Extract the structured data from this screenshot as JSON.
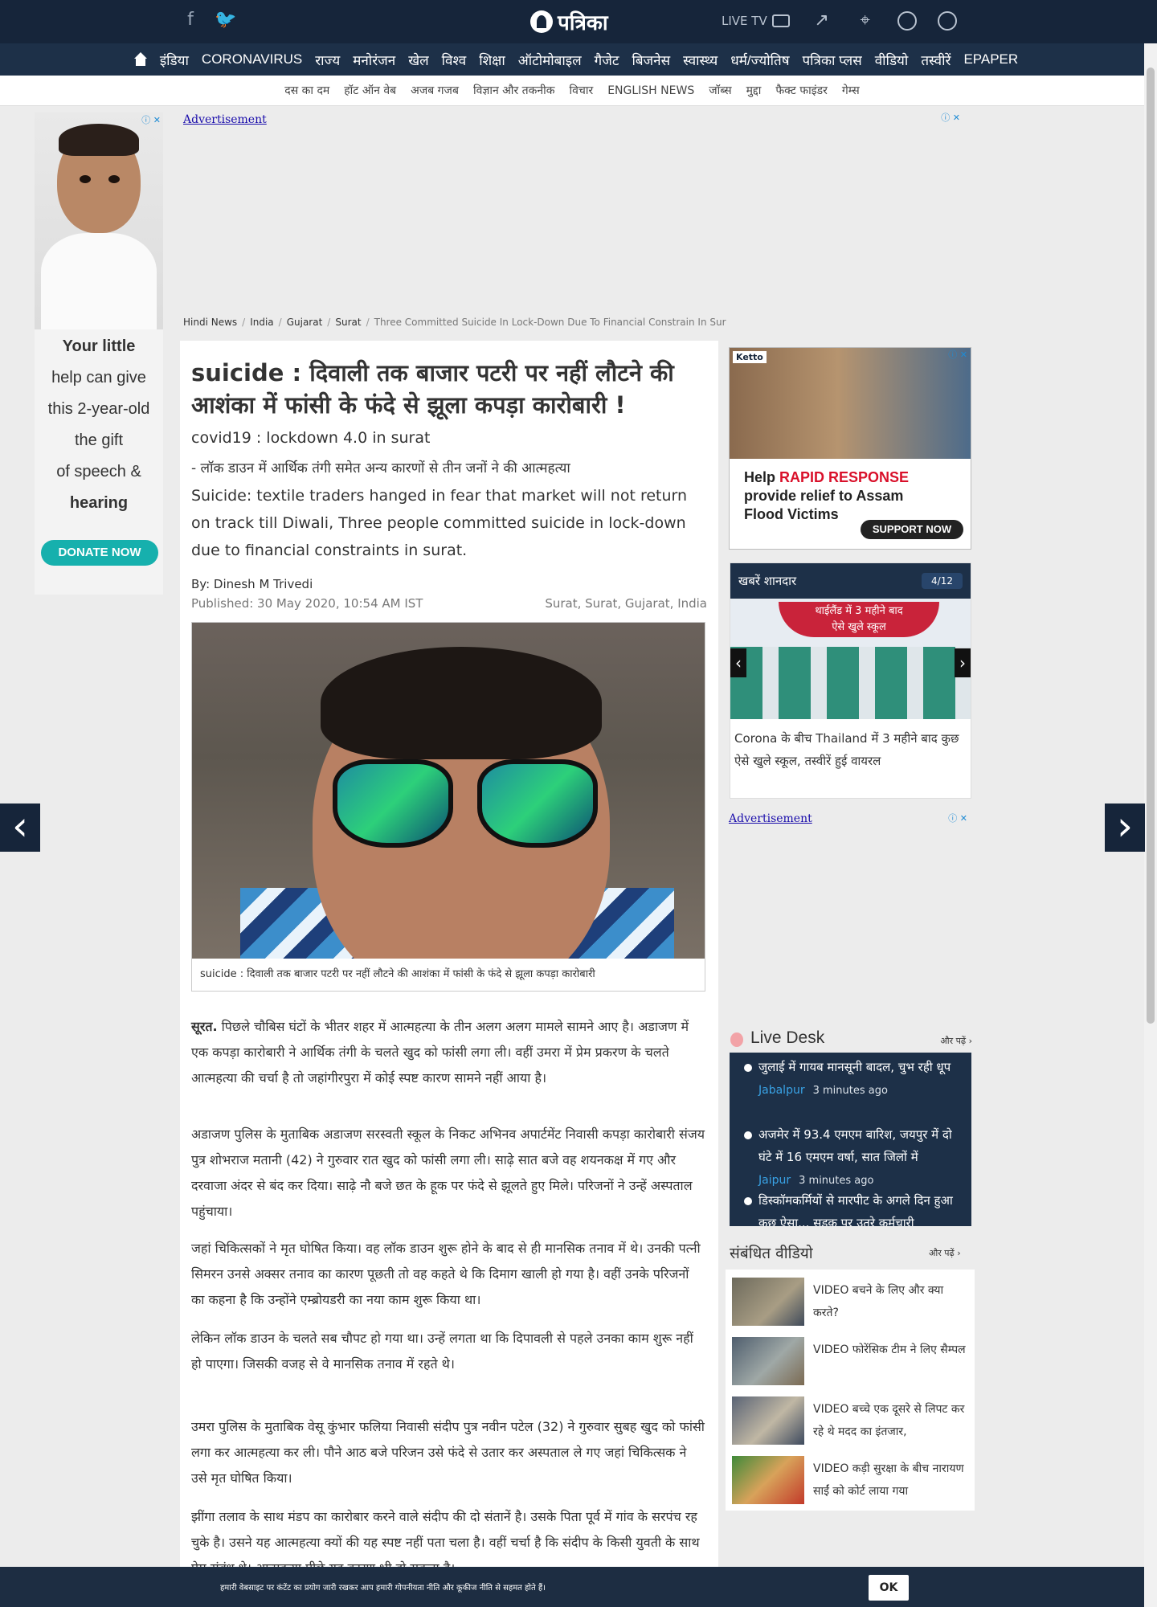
{
  "header": {
    "logo_text": "पत्रिका",
    "live_tv": "LIVE TV",
    "social": [
      "facebook-icon",
      "twitter-icon"
    ],
    "icons": [
      "tv-icon",
      "trending-icon",
      "location-icon",
      "search-icon",
      "user-icon"
    ]
  },
  "nav_primary": [
    "इंडिया",
    "CORONAVIRUS",
    "राज्य",
    "मनोरंजन",
    "खेल",
    "विश्व",
    "शिक्षा",
    "ऑटोमोबाइल",
    "गैजेट",
    "बिजनेस",
    "स्वास्थ्य",
    "धर्म/ज्योतिष",
    "पत्रिका प्लस",
    "वीडियो",
    "तस्वीरें",
    "EPAPER"
  ],
  "nav_secondary": [
    "दस का दम",
    "हॉट ऑन वेब",
    "अजब गजब",
    "विज्ञान और तकनीक",
    "विचार",
    "ENGLISH NEWS",
    "जॉब्स",
    "मुद्दा",
    "फैक्ट फाइंडर",
    "गेम्स"
  ],
  "left_ad": {
    "text_lines": [
      "Your little",
      "help can give",
      "this 2-year-old",
      "the gift",
      "of speech &",
      "hearing"
    ],
    "donate": "DONATE NOW"
  },
  "ads": {
    "label": "Advertisement"
  },
  "breadcrumb": [
    "Hindi News",
    "India",
    "Gujarat",
    "Surat",
    "Three Committed Suicide In Lock-Down Due To Financial Constrain In Sur"
  ],
  "article": {
    "title": "suicide : दिवाली तक बाजार पटरी पर नहीं लौटने की आशंका में फांसी के फंदे से झूला कपड़ा कारोबारी !",
    "subtitle1": "covid19 : lockdown 4.0 in surat",
    "subtitle2": "- लॉक डाउन में आर्थिक तंगी समेत अन्य कारणों से तीन जनों ने की आत्महत्या",
    "subtitle3": "Suicide: textile traders hanged in fear that market will not return on track till Diwali, Three people committed suicide in lock-down due to financial constraints in surat.",
    "byline": "By: Dinesh M Trivedi",
    "published": "Published: 30 May 2020, 10:54 AM IST",
    "place": "Surat, Surat, Gujarat, India",
    "image_caption": "suicide : दिवाली तक बाजार पटरी पर नहीं लौटने की आशंका में फांसी के फंदे से झूला कपड़ा कारोबारी",
    "lead_strong": "सूरत.",
    "paragraphs": [
      " पिछले चौबिस घंटों के भीतर शहर में आत्महत्या के तीन अलग अलग मामले सामने आए है। अडाजण में एक कपड़ा कारोबारी ने आर्थिक तंगी के चलते खुद को फांसी लगा ली। वहीं उमरा में प्रेम प्रकरण के चलते आत्महत्या की चर्चा है तो जहांगीरपुरा में कोई स्पष्ट कारण सामने नहीं आया है।",
      "अडाजण पुलिस के मुताबिक अडाजण सरस्वती स्कूल के निकट अभिनव अपार्टमेंट निवासी कपड़ा कारोबारी संजय पुत्र शोभराज मतानी (42) ने गुरुवार रात खुद को फांसी लगा ली। साढ़े सात बजे वह शयनकक्ष में गए और दरवाजा अंदर से बंद कर दिया। साढ़े नौ बजे छत के हूक पर फंदे से झूलते हुए मिले। परिजनों ने उन्हें अस्पताल पहुंचाया।",
      "जहां चिकित्सकों ने मृत घोषित किया। वह लॉक डाउन शुरू होने के बाद से ही मानसिक तनाव में थे। उनकी पत्नी सिमरन उनसे अक्सर तनाव का कारण पूछती तो वह कहते थे कि दिमाग खाली हो गया है। वहीं उनके परिजनों का कहना है कि उन्होंने एम्ब्रोयडरी का नया काम शुरू किया था।",
      "लेकिन लॉक डाउन के चलते सब चौपट हो गया था। उन्हें लगता था कि दिपावली से पहले उनका काम शुरू नहीं हो पाएगा। जिसकी वजह से वे मानसिक तनाव में रहते थे।",
      "उमरा पुलिस के मुताबिक वेसू कुंभार फलिया निवासी संदीप पुत्र नवीन पटेल (32) ने गुरुवार सुबह खुद को फांसी लगा कर आत्महत्या कर ली। पौने आठ बजे परिजन उसे फंदे से उतार कर अस्पताल ले गए जहां चिकित्सक ने उसे मृत घोषित किया।",
      "झींगा तलाव के साथ मंडप का कारोबार करने वाले संदीप की दो संतानें है। उसके पिता पूर्व में गांव के सरपंच रह चुके है। उसने यह आत्महत्या क्यों की यह स्पष्ट नहीं पता चला है। वहीं चर्चा है कि संदीप के किसी युवती के साथ प्रेम संबंध थे। आत्महत्या पीछे यह कारण भी हो सकता है।"
    ]
  },
  "side_ad": {
    "brand": "Ketto",
    "help": "Help",
    "rapid": "RAPID RESPONSE",
    "line2": "provide relief to Assam",
    "line3": "Flood Victims",
    "support": "SUPPORT NOW"
  },
  "khabre": {
    "title": "खबरें शानदार",
    "count": "4/12",
    "banner_line1": "थाईलैंड में 3 महीने बाद",
    "banner_line2": "ऐसे खुले स्कूल",
    "caption": "Corona के बीच Thailand में 3 महीने बाद कुछ ऐसे खुले स्कूल, तस्वीरें हुई वायरल"
  },
  "live_desk": {
    "title": "Live Desk",
    "more": "और पढ़ें",
    "items": [
      {
        "text": "जुलाई में गायब मानसूनी बादल, चुभ रही धूप",
        "city": "Jabalpur",
        "ago": "3 minutes ago"
      },
      {
        "text": "अजमेर में 93.4 एमएम बारिश, जयपुर में दो घंटे में 16 एमएम वर्षा, सात जिलों में",
        "city": "Jaipur",
        "ago": "3 minutes ago"
      },
      {
        "text": "डिस्कॉमकर्मियों से मारपीट के अगले दिन हुआ कुछ ऐसा... सड़क पर उतरे कर्मचारी",
        "city": "",
        "ago": ""
      }
    ]
  },
  "related_videos": {
    "title": "संबंधित वीडियो",
    "more": "और पढ़ें",
    "items": [
      "VIDEO बचने के लिए और क्या करते?",
      "VIDEO फोरेंसिक टीम ने लिए सैम्पल",
      "VIDEO बच्चे एक दूसरे से लिपट कर रहे थे मदद का इंतजार,",
      "VIDEO कड़ी सुरक्षा के बीच नारायण साईं को कोर्ट लाया गया"
    ]
  },
  "cookie": {
    "text": "हमारी वेबसाइट पर कंटेंट का प्रयोग जारी रखकर आप हमारी गोपनीयता नीति और कूकीज नीति से सहमत होते हैं।",
    "ok": "OK"
  }
}
